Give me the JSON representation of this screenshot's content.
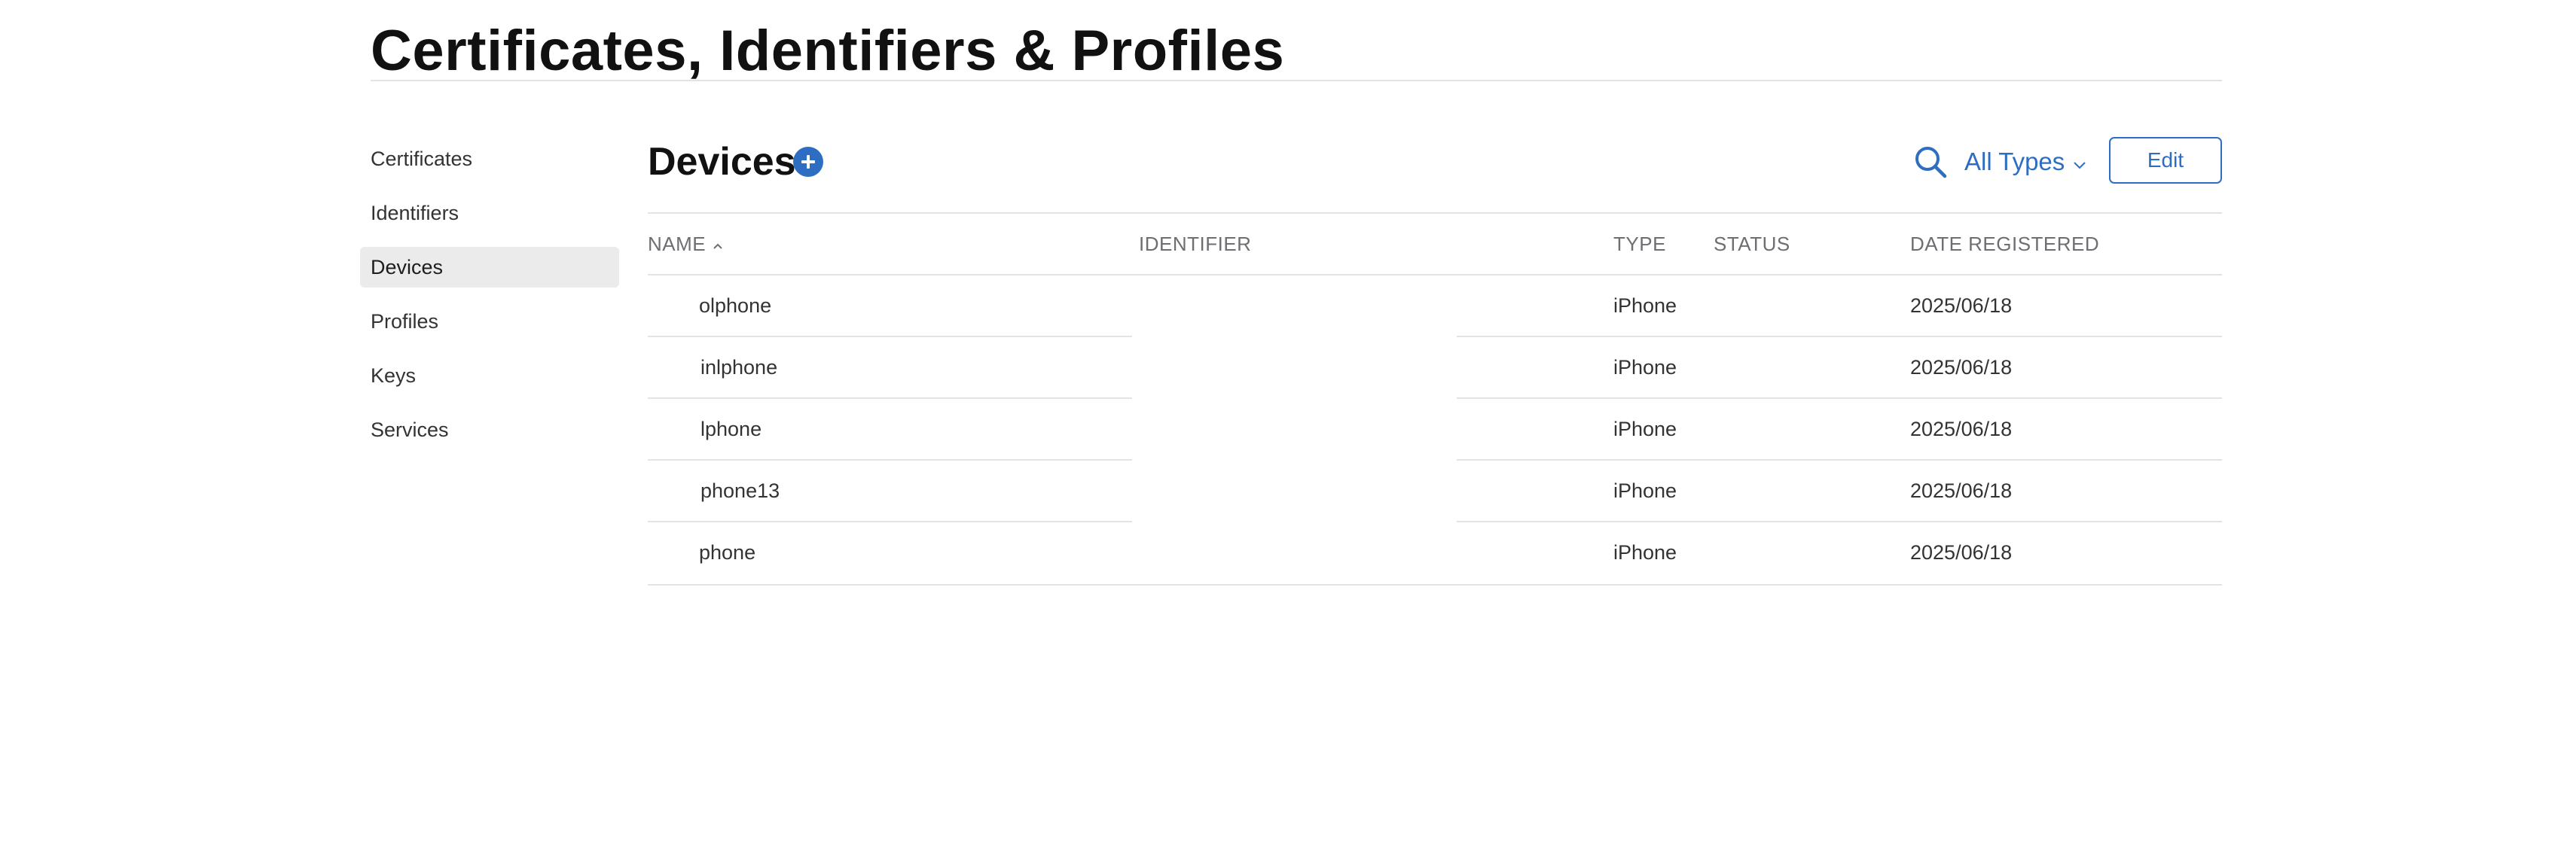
{
  "header": {
    "title": "Certificates, Identifiers & Profiles"
  },
  "sidebar": {
    "items": [
      {
        "label": "Certificates",
        "active": false
      },
      {
        "label": "Identifiers",
        "active": false
      },
      {
        "label": "Devices",
        "active": true
      },
      {
        "label": "Profiles",
        "active": false
      },
      {
        "label": "Keys",
        "active": false
      },
      {
        "label": "Services",
        "active": false
      }
    ]
  },
  "main": {
    "title": "Devices",
    "add_icon": "plus-circle-icon",
    "search_icon": "search-icon",
    "type_filter": "All Types",
    "type_filter_icon": "chevron-down-icon",
    "edit_label": "Edit",
    "accent_color": "#2d6ec3"
  },
  "table": {
    "columns": {
      "name": "NAME",
      "identifier": "IDENTIFIER",
      "type": "TYPE",
      "status": "STATUS",
      "date": "DATE REGISTERED"
    },
    "sort_icon": "chevron-up-icon",
    "rows": [
      {
        "name": "olphone",
        "identifier": "",
        "type": "iPhone",
        "status": "",
        "date": "2025/06/18"
      },
      {
        "name": "inlphone",
        "identifier": "",
        "type": "iPhone",
        "status": "",
        "date": "2025/06/18"
      },
      {
        "name": "lphone",
        "identifier": "",
        "type": "iPhone",
        "status": "",
        "date": "2025/06/18"
      },
      {
        "name": "phone13",
        "identifier": "",
        "type": "iPhone",
        "status": "",
        "date": "2025/06/18"
      },
      {
        "name": "phone",
        "identifier": "",
        "type": "iPhone",
        "status": "",
        "date": "2025/06/18"
      }
    ]
  }
}
